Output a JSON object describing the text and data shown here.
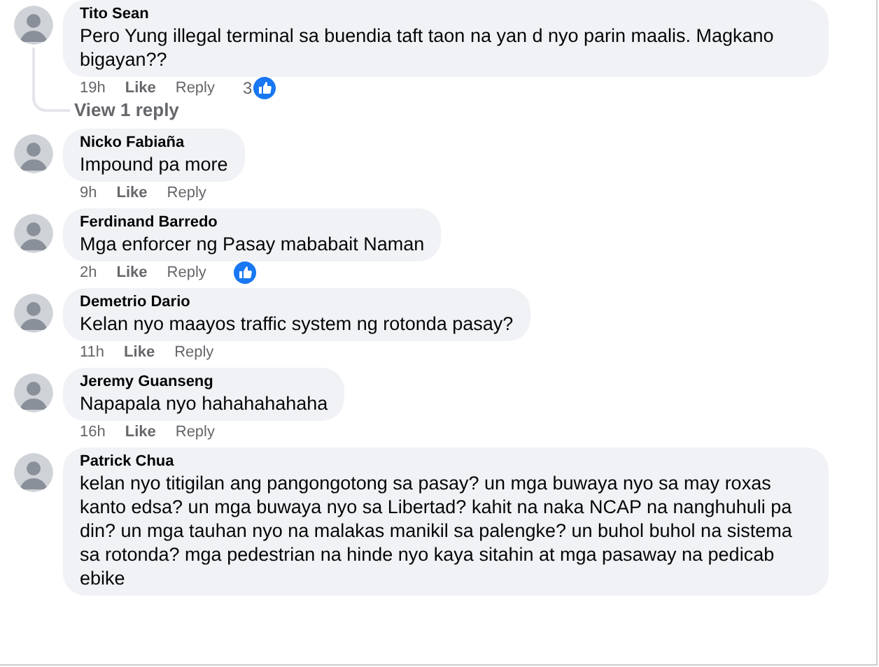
{
  "comments": [
    {
      "name": "Tito Sean",
      "text": "Pero Yung illegal terminal sa buendia taft taon na yan d nyo parin maalis. Magkano bigayan??",
      "time": "19h",
      "like": "Like",
      "reply": "Reply",
      "reactions": {
        "kind": "like",
        "count": "3"
      },
      "replies_link": "View 1 reply"
    },
    {
      "name": "Nicko Fabiaña",
      "text": "Impound pa more",
      "time": "9h",
      "like": "Like",
      "reply": "Reply"
    },
    {
      "name": "Ferdinand Barredo",
      "text": "Mga enforcer ng Pasay mababait Naman",
      "time": "2h",
      "like": "Like",
      "reply": "Reply",
      "reactions": {
        "kind": "like"
      }
    },
    {
      "name": "Demetrio Dario",
      "text": "Kelan nyo maayos traffic system ng rotonda pasay?",
      "time": "11h",
      "like": "Like",
      "reply": "Reply"
    },
    {
      "name": "Jeremy Guanseng",
      "text": "Napapala nyo hahahahahaha",
      "time": "16h",
      "like": "Like",
      "reply": "Reply"
    },
    {
      "name": "Patrick Chua",
      "text": "kelan nyo titigilan ang pangongotong sa pasay? un mga buwaya nyo sa may roxas kanto edsa? un mga buwaya nyo sa Libertad? kahit na naka NCAP na nanghuhuli pa din? un mga tauhan nyo na malakas manikil sa palengke? un buhol buhol na sistema sa rotonda? mga pedestrian na hinde nyo kaya sitahin at mga pasaway na pedicab ebike"
    }
  ]
}
